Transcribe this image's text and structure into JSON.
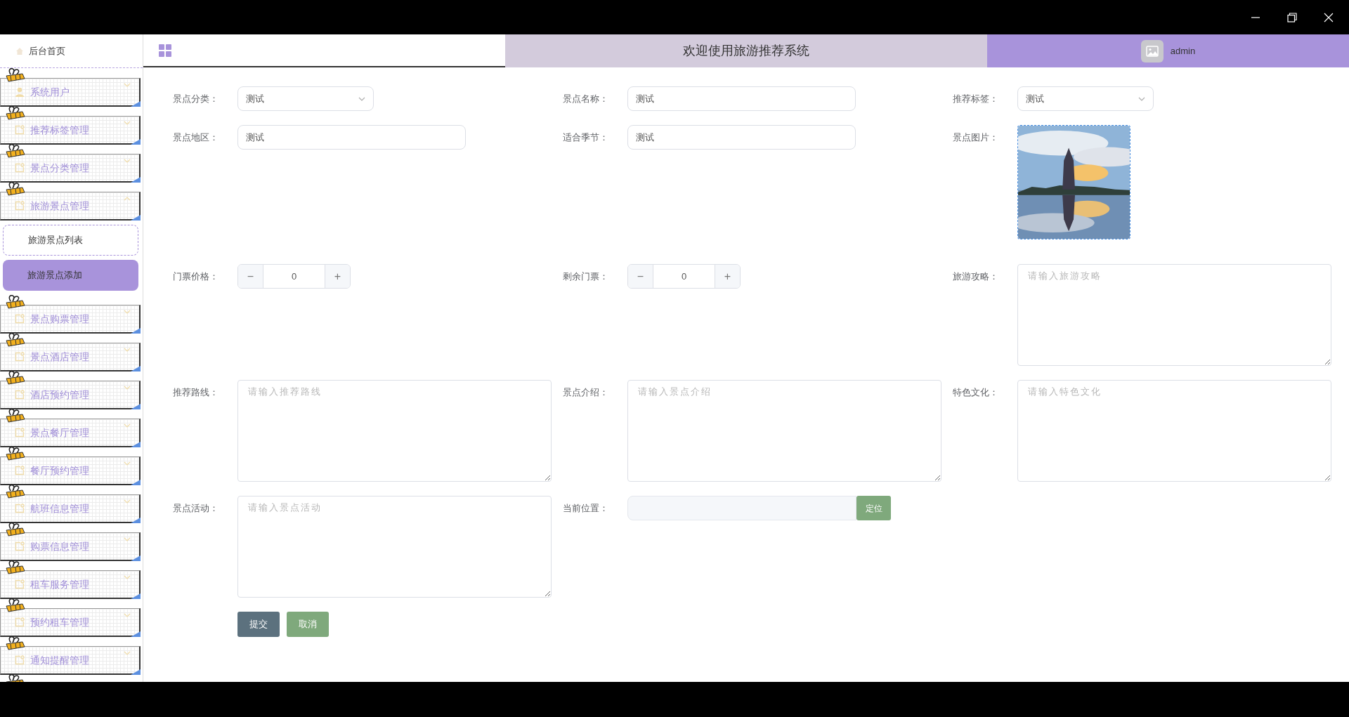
{
  "sidebar": {
    "home": {
      "label": "后台首页"
    },
    "menu": [
      {
        "label": "系统用户",
        "kind": "user",
        "expanded": false
      },
      {
        "label": "推荐标签管理",
        "kind": "folder",
        "expanded": false
      },
      {
        "label": "景点分类管理",
        "kind": "folder",
        "expanded": false
      },
      {
        "label": "旅游景点管理",
        "kind": "folder",
        "expanded": true,
        "children": [
          {
            "label": "旅游景点列表",
            "selected": false
          },
          {
            "label": "旅游景点添加",
            "selected": true
          }
        ]
      },
      {
        "label": "景点购票管理",
        "kind": "folder",
        "expanded": false
      },
      {
        "label": "景点酒店管理",
        "kind": "folder",
        "expanded": false
      },
      {
        "label": "酒店预约管理",
        "kind": "folder",
        "expanded": false
      },
      {
        "label": "景点餐厅管理",
        "kind": "folder",
        "expanded": false
      },
      {
        "label": "餐厅预约管理",
        "kind": "folder",
        "expanded": false
      },
      {
        "label": "航班信息管理",
        "kind": "folder",
        "expanded": false
      },
      {
        "label": "购票信息管理",
        "kind": "folder",
        "expanded": false
      },
      {
        "label": "租车服务管理",
        "kind": "folder",
        "expanded": false
      },
      {
        "label": "预约租车管理",
        "kind": "folder",
        "expanded": false
      },
      {
        "label": "通知提醒管理",
        "kind": "folder",
        "expanded": false
      }
    ]
  },
  "header": {
    "title": "欢迎使用旅游推荐系统",
    "user": "admin"
  },
  "form": {
    "rows": [
      [
        {
          "label": "景点分类：",
          "kind": "select",
          "value": "测试"
        },
        {
          "label": "景点名称：",
          "kind": "text",
          "value": "测试"
        },
        {
          "label": "推荐标签：",
          "kind": "select",
          "value": "测试"
        }
      ],
      [
        {
          "label": "景点地区：",
          "kind": "text",
          "value": "测试"
        },
        {
          "label": "适合季节：",
          "kind": "text",
          "value": "测试"
        },
        {
          "label": "景点图片：",
          "kind": "picture"
        }
      ],
      [
        {
          "label": "门票价格：",
          "kind": "number",
          "value": "0",
          "minus": "−",
          "plus": "+"
        },
        {
          "label": "剩余门票：",
          "kind": "number",
          "value": "0",
          "minus": "−",
          "plus": "+"
        },
        {
          "label": "旅游攻略：",
          "kind": "textarea",
          "placeholder": "请输入旅游攻略"
        }
      ],
      [
        {
          "label": "推荐路线：",
          "kind": "textarea",
          "placeholder": "请输入推荐路线"
        },
        {
          "label": "景点介绍：",
          "kind": "textarea",
          "placeholder": "请输入景点介绍"
        },
        {
          "label": "特色文化：",
          "kind": "textarea",
          "placeholder": "请输入特色文化"
        }
      ],
      [
        {
          "label": "景点活动：",
          "kind": "textarea",
          "placeholder": "请输入景点活动"
        },
        {
          "label": "当前位置：",
          "kind": "location",
          "button": "定位"
        }
      ]
    ],
    "buttons": [
      {
        "label": "提交",
        "kind": "submit"
      },
      {
        "label": "取消",
        "kind": "cancel"
      }
    ]
  }
}
